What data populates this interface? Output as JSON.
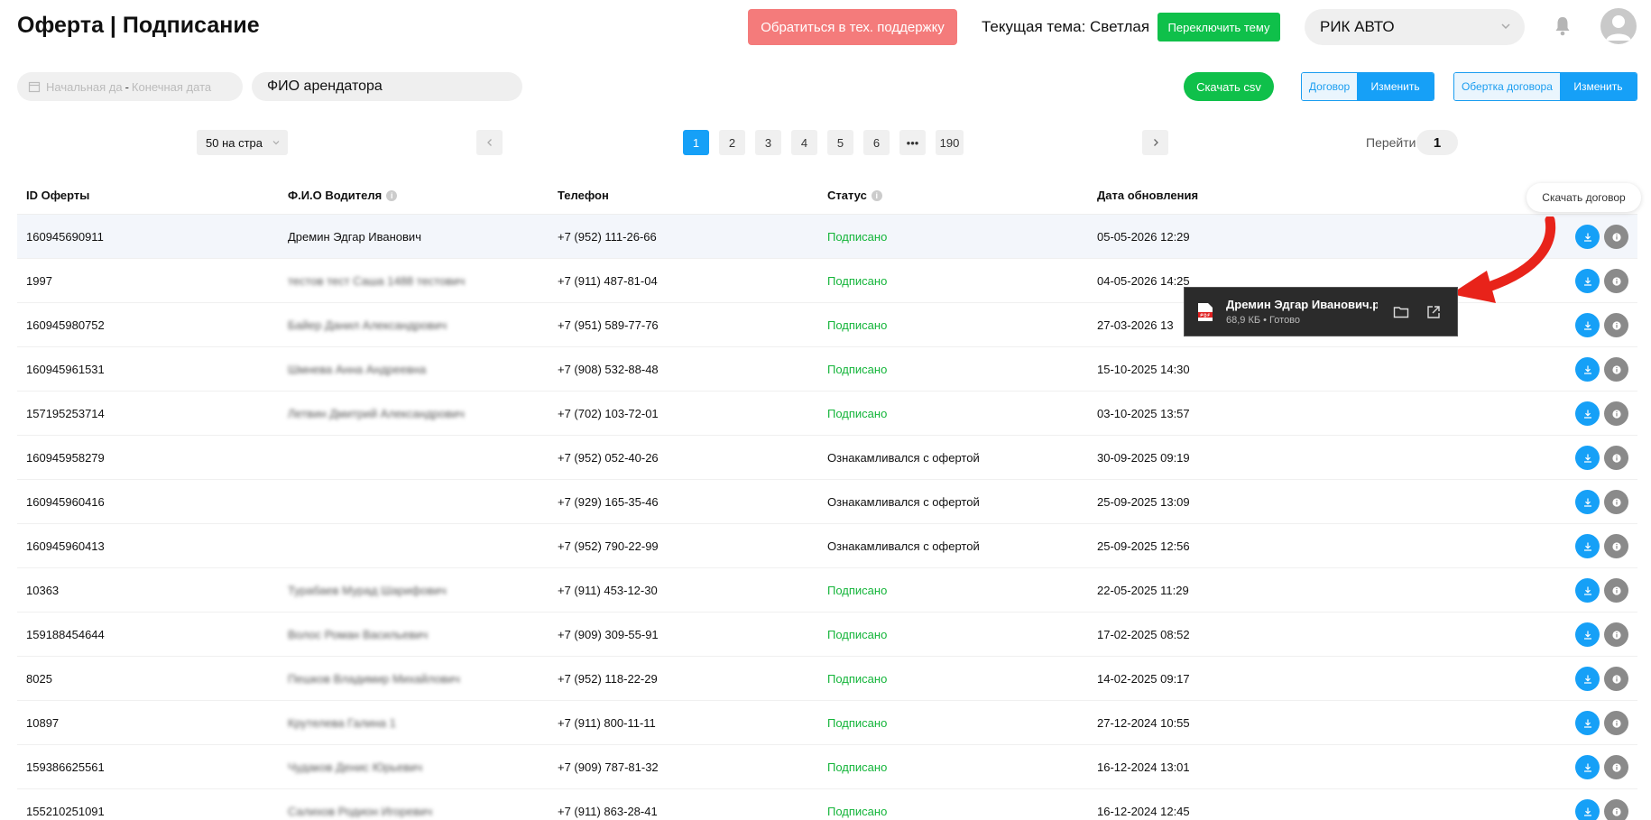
{
  "header": {
    "title": "Оферта | Подписание",
    "support_label": "Обратиться в тех. поддержку",
    "theme_label": "Текущая тема: Светлая",
    "switch_theme_label": "Переключить тему",
    "company": "РИК АВТО"
  },
  "filters": {
    "start_placeholder": "Начальная да",
    "end_placeholder": "Конечная дата",
    "separator": "-",
    "fio_value": "ФИО арендатора",
    "csv_label": "Скачать csv",
    "contract_label": "Договор",
    "contract_action": "Изменить",
    "wrapper_label": "Обертка договора",
    "wrapper_action": "Изменить"
  },
  "pagination": {
    "per_page": "50 на стра",
    "pages": [
      "1",
      "2",
      "3",
      "4",
      "5",
      "6",
      "•••",
      "190"
    ],
    "active_page": "1",
    "goto_label": "Перейти",
    "goto_value": "1"
  },
  "table": {
    "columns": [
      "ID Оферты",
      "Ф.И.О Водителя",
      "Телефон",
      "Статус",
      "Дата обновления"
    ],
    "rows": [
      {
        "id": "160945690911",
        "fio": "Дремин Эдгар Иванович",
        "phone": "+7 (952) 111-26-66",
        "status": "Подписано",
        "date": "05-05-2026 12:29"
      },
      {
        "id": "1997",
        "fio": "тестов тест Саша 1488 тестович",
        "phone": "+7 (911) 487-81-04",
        "status": "Подписано",
        "date": "04-05-2026 14:25"
      },
      {
        "id": "160945980752",
        "fio": "Байер Данил Александрович",
        "phone": "+7 (951) 589-77-76",
        "status": "Подписано",
        "date": "27-03-2026 13"
      },
      {
        "id": "160945961531",
        "fio": "Шмнева Анна Андреевна",
        "phone": "+7 (908) 532-88-48",
        "status": "Подписано",
        "date": "15-10-2025 14:30"
      },
      {
        "id": "157195253714",
        "fio": "Летвин Дмитрий Александрович",
        "phone": "+7 (702) 103-72-01",
        "status": "Подписано",
        "date": "03-10-2025 13:57"
      },
      {
        "id": "160945958279",
        "fio": "",
        "phone": "+7 (952) 052-40-26",
        "status": "Ознакамливался с офертой",
        "date": "30-09-2025 09:19"
      },
      {
        "id": "160945960416",
        "fio": "",
        "phone": "+7 (929) 165-35-46",
        "status": "Ознакамливался с офертой",
        "date": "25-09-2025 13:09"
      },
      {
        "id": "160945960413",
        "fio": "",
        "phone": "+7 (952) 790-22-99",
        "status": "Ознакамливался с офертой",
        "date": "25-09-2025 12:56"
      },
      {
        "id": "10363",
        "fio": "Турабаев Мурад Шарифович",
        "phone": "+7 (911) 453-12-30",
        "status": "Подписано",
        "date": "22-05-2025 11:29"
      },
      {
        "id": "159188454644",
        "fio": "Волос Роман Васильевич",
        "phone": "+7 (909) 309-55-91",
        "status": "Подписано",
        "date": "17-02-2025 08:52"
      },
      {
        "id": "8025",
        "fio": "Пешков Владимир Михайлович",
        "phone": "+7 (952) 118-22-29",
        "status": "Подписано",
        "date": "14-02-2025 09:17"
      },
      {
        "id": "10897",
        "fio": "Крутелева Галина 1",
        "phone": "+7 (911) 800-11-11",
        "status": "Подписано",
        "date": "27-12-2024 10:55"
      },
      {
        "id": "159386625561",
        "fio": "Чудаков Денис Юрьевич",
        "phone": "+7 (909) 787-81-32",
        "status": "Подписано",
        "date": "16-12-2024 13:01"
      },
      {
        "id": "155210251091",
        "fio": "Салихов Родион Игоревич",
        "phone": "+7 (911) 863-28-41",
        "status": "Подписано",
        "date": "16-12-2024 12:45"
      }
    ]
  },
  "tooltip": {
    "text": "Скачать договор"
  },
  "download": {
    "filename": "Дремин Эдгар Иванович.pdf",
    "subtitle": "68,9 КБ • Готово"
  },
  "colors": {
    "accent": "#16a0f7",
    "success": "#0fc04a",
    "status_ok": "#14b53a",
    "danger": "#f47b7b",
    "arrow": "#e8231a"
  },
  "icons": {
    "calendar": "calendar-icon",
    "chevron": "chevron-down-icon",
    "bell": "bell-icon",
    "avatar": "user-avatar-icon",
    "download": "download-icon",
    "info": "info-icon",
    "pdf": "pdf-file-icon",
    "folder": "folder-icon",
    "open": "open-external-icon",
    "arrow": "red-arrow-annotation"
  }
}
